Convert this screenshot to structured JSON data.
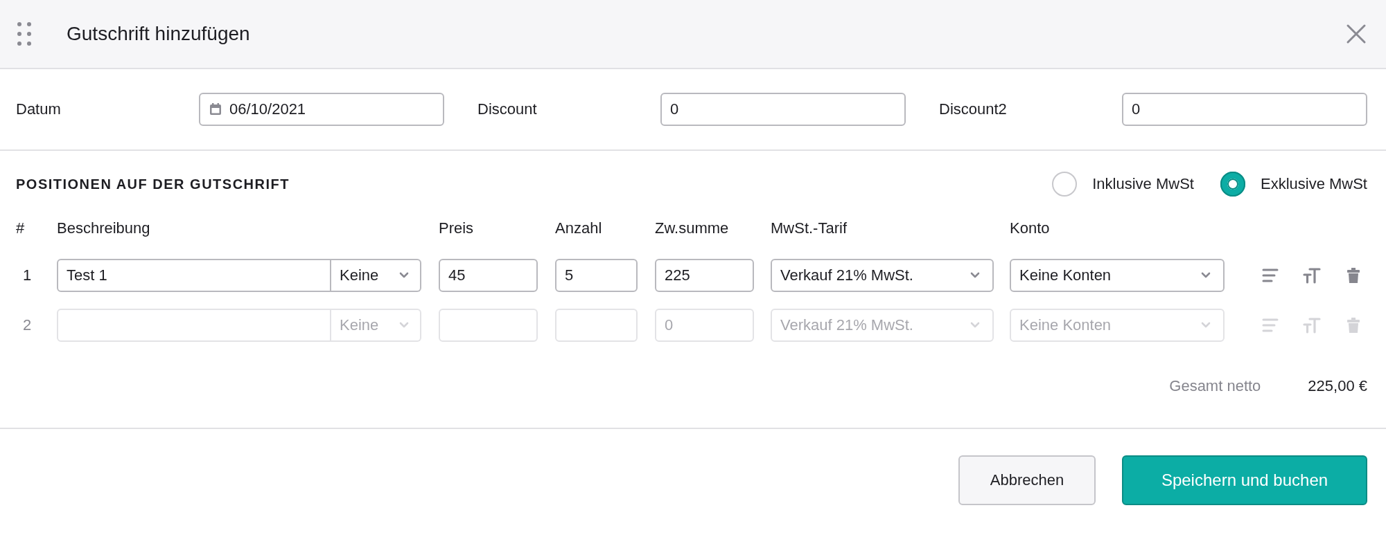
{
  "dialog": {
    "title": "Gutschrift hinzufügen"
  },
  "fields": [
    {
      "label": "Datum",
      "value": "06/10/2021",
      "kind": "date"
    },
    {
      "label": "Discount",
      "value": "0",
      "kind": "text"
    },
    {
      "label": "Discount2",
      "value": "0",
      "kind": "text"
    }
  ],
  "section": {
    "title": "POSITIONEN AUF DER GUTSCHRIFT"
  },
  "tax_mode": [
    {
      "label": "Inklusive MwSt",
      "selected": false
    },
    {
      "label": "Exklusive MwSt",
      "selected": true
    }
  ],
  "table": {
    "columns": [
      "#",
      "Beschreibung",
      "Preis",
      "Anzahl",
      "Zw.summe",
      "MwSt.-Tarif",
      "Konto"
    ],
    "rows": [
      {
        "number": "1",
        "disabled": false,
        "description": "Test 1",
        "unit": "Keine",
        "price": "45",
        "quantity": "5",
        "subtotal": "225",
        "tax_rate": "Verkauf 21% MwSt.",
        "account": "Keine Konten"
      },
      {
        "number": "2",
        "disabled": true,
        "unit": "Keine",
        "subtotal": "0",
        "tax_rate": "Verkauf 21% MwSt.",
        "account": "Keine Konten"
      }
    ]
  },
  "total": {
    "label": "Gesamt netto",
    "value": "225,00 €"
  },
  "buttons": [
    {
      "label": "Abbrechen",
      "kind": "secondary"
    },
    {
      "label": "Speichern und buchen",
      "kind": "primary"
    }
  ]
}
